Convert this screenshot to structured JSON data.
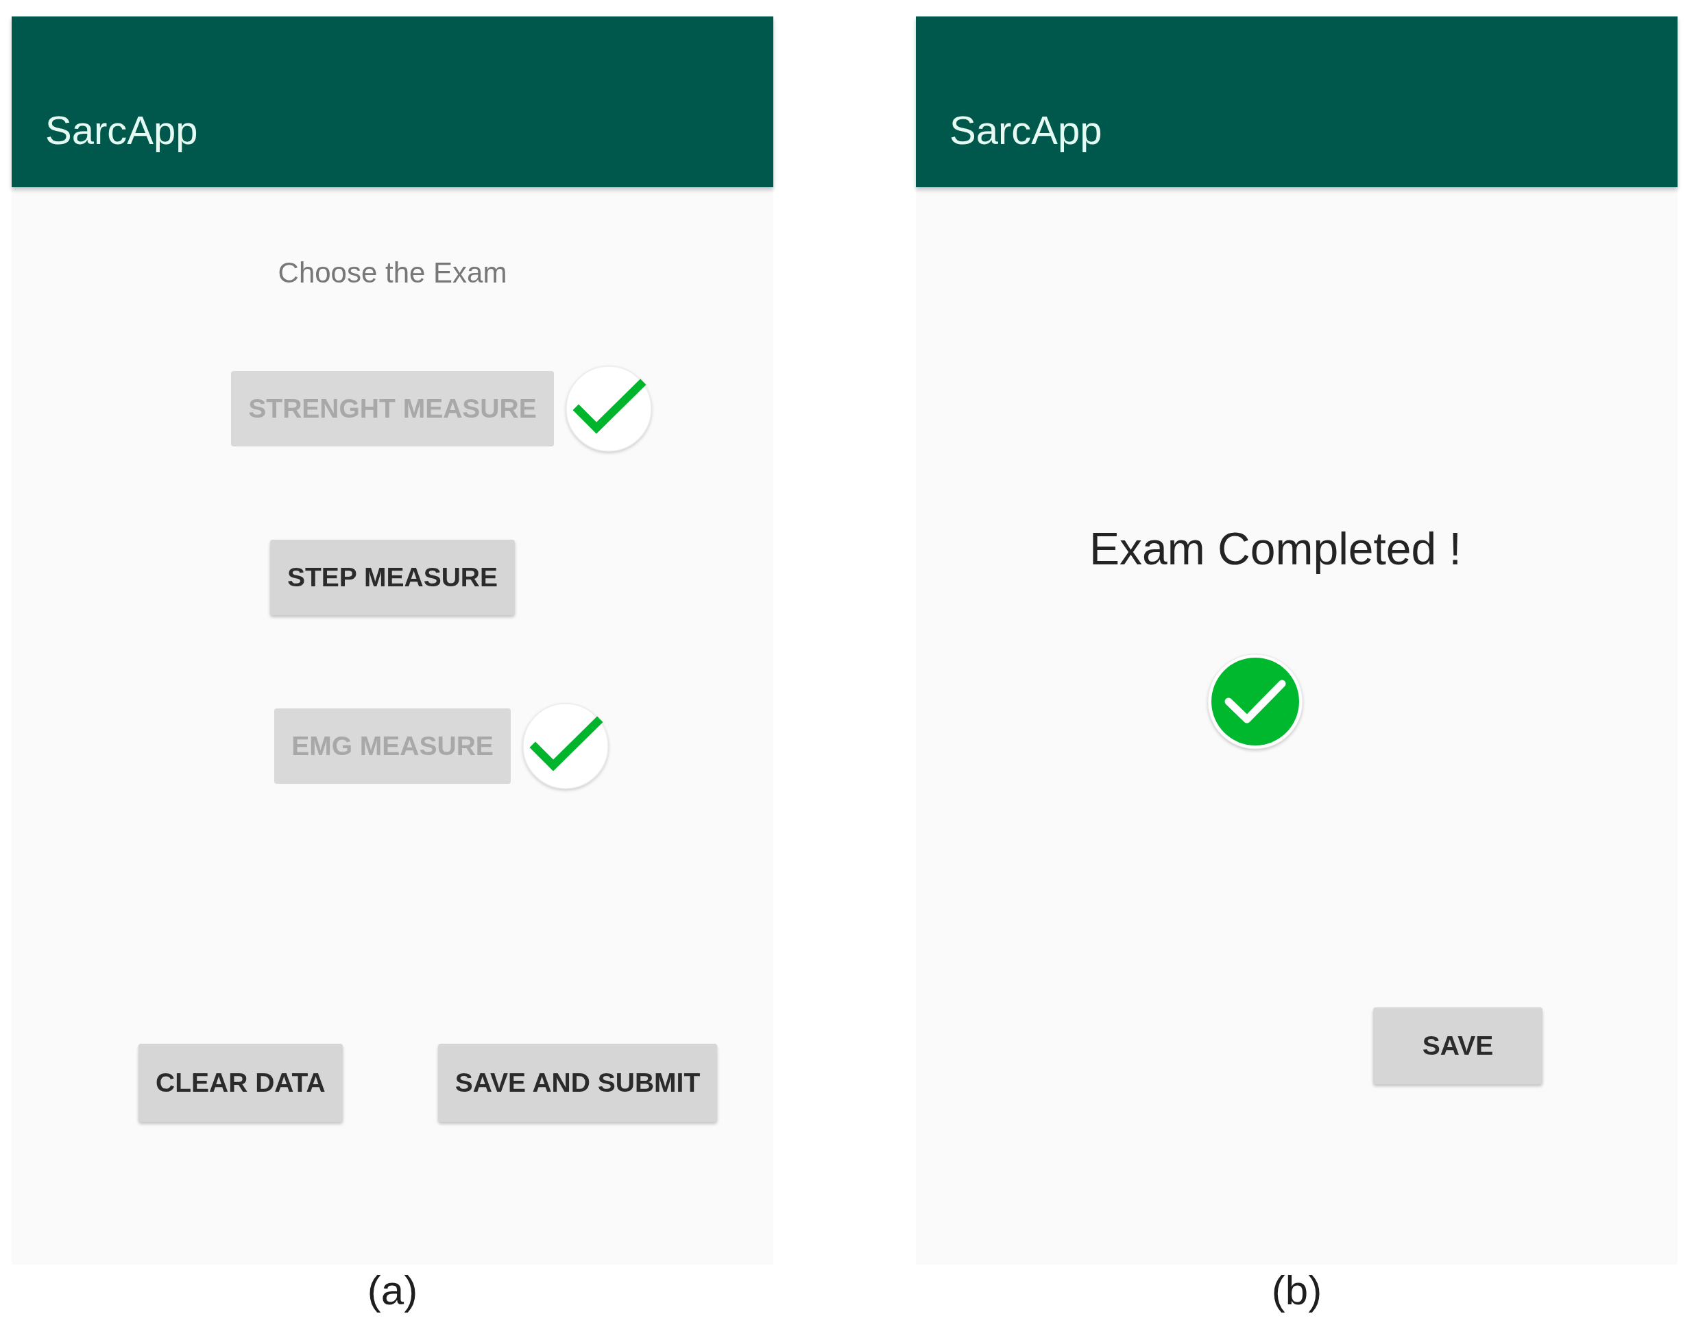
{
  "panels": [
    {
      "kind": "exam-menu",
      "app_bar": {
        "title": "SarcApp"
      },
      "prompt": "Choose the Exam",
      "exams": [
        {
          "label": "STRENGHT MEASURE",
          "disabled": true,
          "checked": true
        },
        {
          "label": "STEP MEASURE",
          "disabled": false,
          "checked": false
        },
        {
          "label": "EMG MEASURE",
          "disabled": true,
          "checked": true
        }
      ],
      "actions": [
        {
          "label": "CLEAR DATA"
        },
        {
          "label": "SAVE AND SUBMIT"
        }
      ],
      "caption": "(a)"
    },
    {
      "kind": "completed",
      "app_bar": {
        "title": "SarcApp"
      },
      "message": "Exam Completed !",
      "actions": [
        {
          "label": "SAVE"
        }
      ],
      "caption": "(b)"
    }
  ]
}
